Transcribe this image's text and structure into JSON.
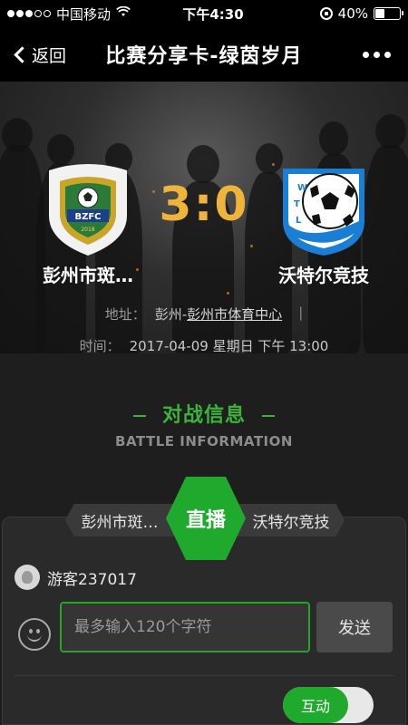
{
  "status_bar": {
    "carrier": "中国移动",
    "time": "下午4:30",
    "battery_percent": "40%",
    "battery_level": 0.4,
    "signal_dots": 5,
    "signal_filled": 3
  },
  "nav": {
    "back_label": "返回",
    "title": "比赛分享卡-绿茵岁月"
  },
  "match": {
    "home_team": "彭州市斑…",
    "home_badge_text": "BZFC",
    "home_badge_year": "2018",
    "away_team": "沃特尔竞技",
    "away_badge_letters": [
      "W",
      "T",
      "L"
    ],
    "score": "3:0",
    "address_label": "地址：",
    "address_prefix": "彭州-",
    "address_venue": "彭州市体育中心",
    "address_sep": "|",
    "time_label": "时间：",
    "time_value": "2017-04-09 星期日 下午 13:00"
  },
  "battle": {
    "title": "对战信息",
    "subtitle": "BATTLE INFORMATION"
  },
  "live": {
    "left_team": "彭州市斑…",
    "center_label": "直播",
    "right_team": "沃特尔竞技"
  },
  "chat": {
    "guest_name": "游客237017",
    "input_placeholder": "最多输入120个字符",
    "send_label": "发送",
    "toggle_label": "互动"
  },
  "colors": {
    "accent_green": "#1fa92d",
    "score_gold": "#f0b43a"
  }
}
